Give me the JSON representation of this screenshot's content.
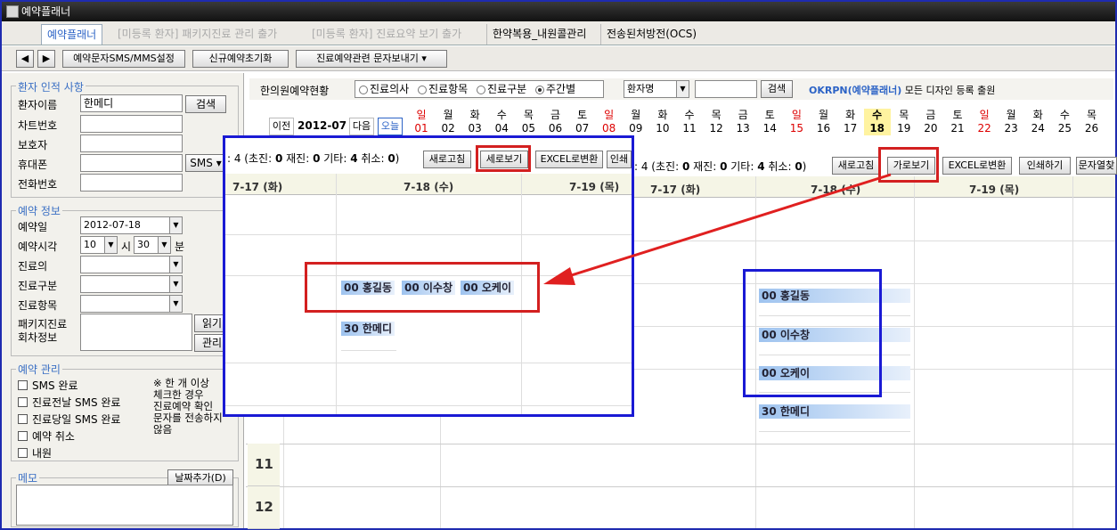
{
  "window": {
    "title": "예약플래너"
  },
  "tabs": [
    {
      "label": "예약플래너"
    },
    {
      "label": "[미등록 환자] 패키지진료 관리 출가"
    },
    {
      "label": "[미등록 환자] 진료요약 보기 출가"
    },
    {
      "label": "한약복용_내원콜관리"
    },
    {
      "label": "전송된처방전(OCS)"
    }
  ],
  "toolbar": {
    "prev": "◀",
    "next": "▶",
    "sms_settings": "예약문자SMS/MMS설정",
    "new_reset": "신규예약초기화",
    "send_text": "진료예약관련 문자보내기"
  },
  "patient": {
    "section": "환자 인적 사항",
    "name_label": "환자이름",
    "name_value": "한메디",
    "search": "검색",
    "chart_label": "차트번호",
    "guardian_label": "보호자",
    "mobile_label": "휴대폰",
    "sms": "SMS",
    "phone_label": "전화번호"
  },
  "reservation": {
    "section": "예약 정보",
    "date_label": "예약일",
    "date_value": "2012-07-18",
    "time_label": "예약시각",
    "hour": "10",
    "hour_unit": "시",
    "minute": "30",
    "minute_unit": "분",
    "doctor_label": "진료의",
    "type_label": "진료구분",
    "item_label": "진료항목",
    "package_label1": "패키지진료",
    "package_label2": "회차정보",
    "read": "읽기",
    "manage": "관리"
  },
  "manage": {
    "section": "예약 관리",
    "items": [
      "SMS 완료",
      "진료전날 SMS 완료",
      "진료당일 SMS 완료",
      "예약 취소",
      "내원"
    ],
    "note": [
      "※ 한 개 이상",
      "체크한 경우",
      "진료예약 확인",
      "문자를 전송하지",
      "않음"
    ]
  },
  "memo": {
    "label": "메모",
    "add_date": "날짜추가(D)"
  },
  "status": {
    "title": "한의원예약현황",
    "options": [
      "진료의사",
      "진료항목",
      "진료구분",
      "주간별"
    ],
    "selected": "주간별",
    "patient_select": "환자명",
    "search": "검색",
    "notice_brand": "OKRPN(예약플래너)",
    "notice_text": " 모든 디자인 등록 출원"
  },
  "calendar": {
    "prev": "이전",
    "month": "2012-07",
    "next": "다음",
    "today": "오늘",
    "days": [
      {
        "d": "일",
        "n": "01",
        "sun": true
      },
      {
        "d": "월",
        "n": "02"
      },
      {
        "d": "화",
        "n": "03"
      },
      {
        "d": "수",
        "n": "04"
      },
      {
        "d": "목",
        "n": "05"
      },
      {
        "d": "금",
        "n": "06"
      },
      {
        "d": "토",
        "n": "07"
      },
      {
        "d": "일",
        "n": "08",
        "sun": true
      },
      {
        "d": "월",
        "n": "09"
      },
      {
        "d": "화",
        "n": "10"
      },
      {
        "d": "수",
        "n": "11"
      },
      {
        "d": "목",
        "n": "12"
      },
      {
        "d": "금",
        "n": "13"
      },
      {
        "d": "토",
        "n": "14"
      },
      {
        "d": "일",
        "n": "15",
        "sun": true
      },
      {
        "d": "월",
        "n": "16"
      },
      {
        "d": "화",
        "n": "17"
      },
      {
        "d": "수",
        "n": "18",
        "today": true
      },
      {
        "d": "목",
        "n": "19"
      },
      {
        "d": "금",
        "n": "20"
      },
      {
        "d": "토",
        "n": "21"
      },
      {
        "d": "일",
        "n": "22",
        "sun": true
      },
      {
        "d": "월",
        "n": "23"
      },
      {
        "d": "화",
        "n": "24"
      },
      {
        "d": "수",
        "n": "25"
      },
      {
        "d": "목",
        "n": "26"
      }
    ]
  },
  "summary": {
    "prefix": ": 4 (초진: ",
    "new": "0",
    "mid1": " 재진: ",
    "revisit": "0",
    "mid2": " 기타: ",
    "other": "4",
    "mid3": " 취소: ",
    "cancel": "0",
    "suffix": ")",
    "refresh": "새로고침",
    "horizontal": "가로보기",
    "vertical": "세로보기",
    "excel": "EXCEL로변환",
    "print": "인쇄하기",
    "print_short": "인쇄",
    "text_sort": "문자열찾"
  },
  "week": {
    "cols": [
      "7-17 (화)",
      "7-18 (수)",
      "7-19 (목)"
    ]
  },
  "hours": [
    "11",
    "12"
  ],
  "appointments": [
    "00 홍길동",
    "00 이수창",
    "00 오케이",
    "30 한메디"
  ]
}
